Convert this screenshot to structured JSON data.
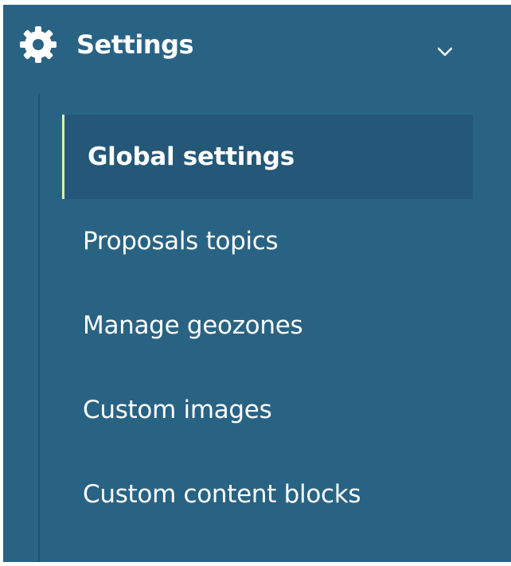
{
  "section": {
    "title": "Settings",
    "icon": "gear-icon",
    "toggle_icon": "chevron-down-icon",
    "expanded": true
  },
  "menu": {
    "items": [
      {
        "label": "Global settings",
        "active": true
      },
      {
        "label": "Proposals topics",
        "active": false
      },
      {
        "label": "Manage geozones",
        "active": false
      },
      {
        "label": "Custom images",
        "active": false
      },
      {
        "label": "Custom content blocks",
        "active": false
      }
    ]
  },
  "colors": {
    "panel_background": "#296384",
    "active_background": "#245778",
    "active_indicator": "#e3ecb4",
    "text": "#ffffff"
  }
}
